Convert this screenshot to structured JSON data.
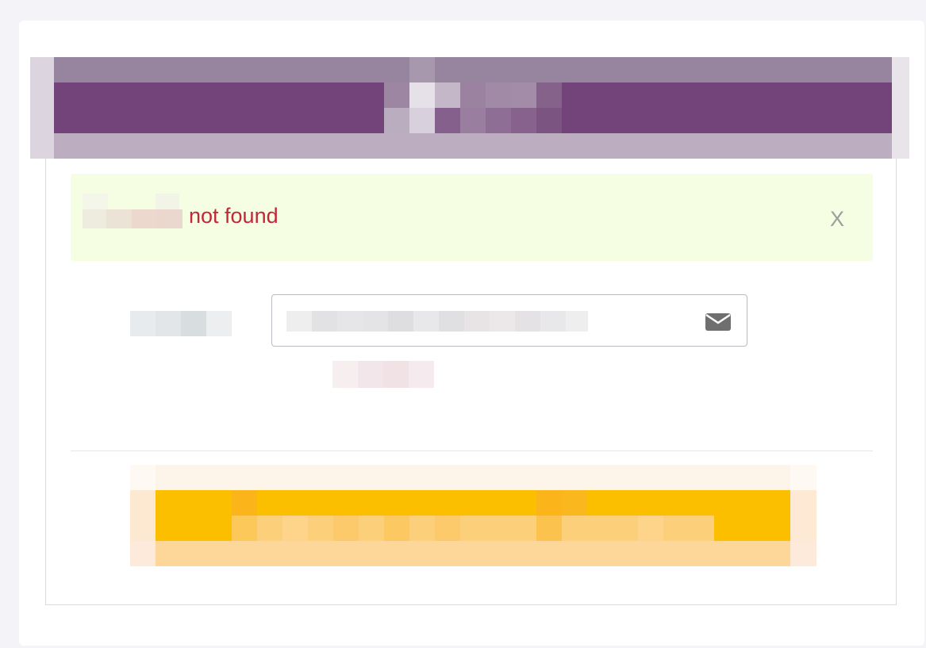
{
  "alert": {
    "message": "not found",
    "close_label": "X"
  },
  "form": {
    "email_icon": "envelope-icon"
  },
  "colors": {
    "header_purple": "#724479",
    "alert_background": "#f5fde3",
    "alert_text": "#c0283a",
    "button_yellow": "#fbbf00"
  }
}
